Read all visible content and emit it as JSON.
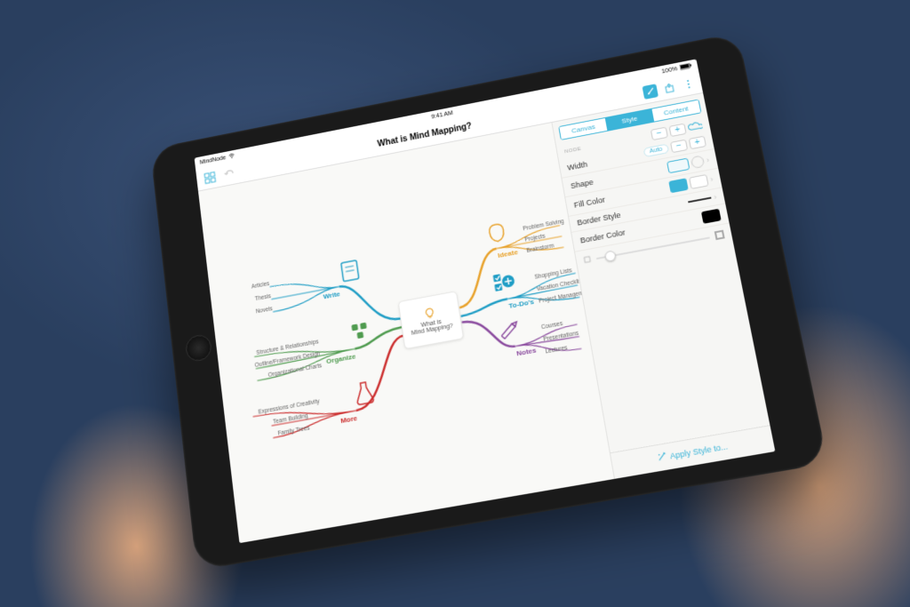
{
  "status": {
    "app": "MindNode",
    "time": "9:41 AM",
    "battery": "100%"
  },
  "nav": {
    "title": "What is Mind Mapping?"
  },
  "panel": {
    "segments": [
      "Canvas",
      "Style",
      "Content"
    ],
    "section": "NODE",
    "auto": "Auto",
    "rows": {
      "width": "Width",
      "shape": "Shape",
      "fill": "Fill Color",
      "border_style": "Border Style",
      "border_color": "Border Color"
    },
    "apply": "Apply Style to..."
  },
  "central": "What is\nMind Mapping?",
  "branches": {
    "write": {
      "label": "Write",
      "color": "#1e9dc5",
      "leaves": [
        "Articles",
        "Thesis",
        "Novels"
      ]
    },
    "organize": {
      "label": "Organize",
      "color": "#4f9b4f",
      "leaves": [
        "Structure & Relationships",
        "Outline/Framework Design",
        "Organizational Charts"
      ]
    },
    "more": {
      "label": "More",
      "color": "#cc2f2f",
      "leaves": [
        "Expressions of Creativity",
        "Team Building",
        "Family Trees"
      ]
    },
    "ideate": {
      "label": "Ideate",
      "color": "#e8a22b",
      "leaves": [
        "Problem Solving",
        "Projects",
        "Brainstorm"
      ]
    },
    "todos": {
      "label": "To-Do's",
      "color": "#1e9dc5",
      "leaves": [
        "Shopping Lists",
        "Vacation Checklists",
        "Project Management"
      ]
    },
    "notes": {
      "label": "Notes",
      "color": "#8a4a9e",
      "leaves": [
        "Courses",
        "Presentations",
        "Lectures"
      ]
    }
  }
}
